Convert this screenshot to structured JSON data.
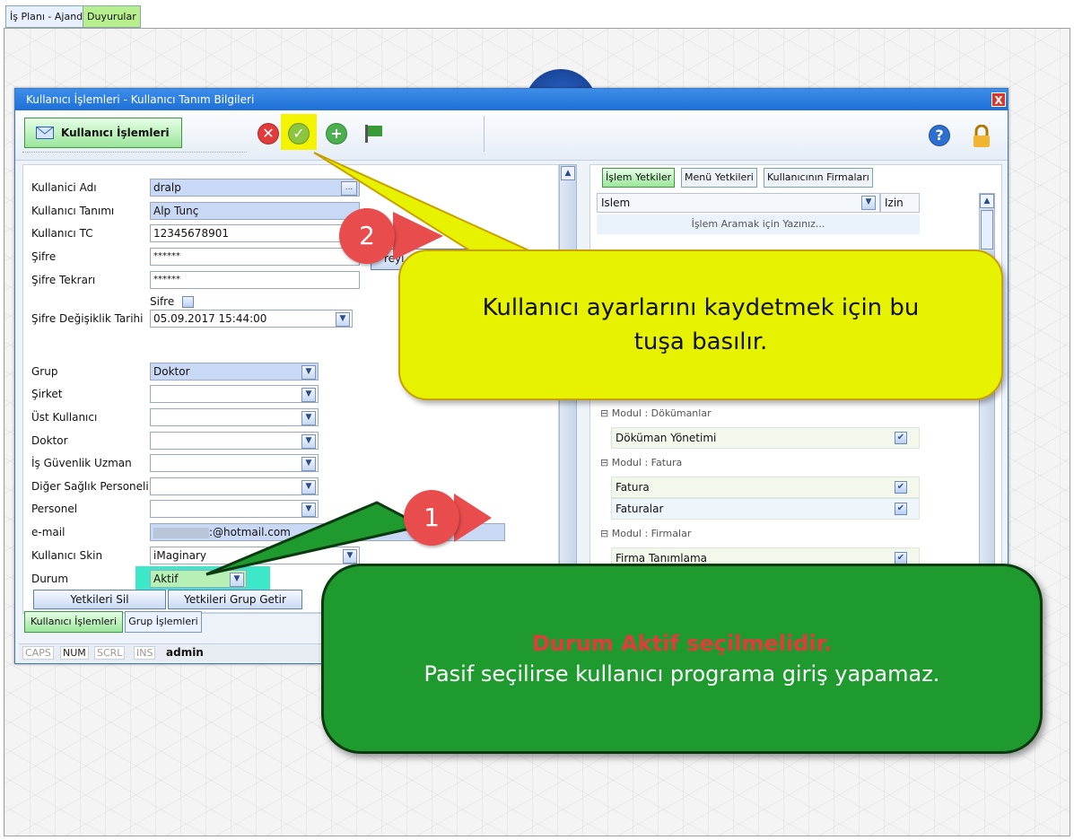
{
  "top_tabs": [
    "İş Planı - Ajanda",
    "Duyurular"
  ],
  "window": {
    "title": "Kullanıcı İşlemleri - Kullanıcı Tanım Bilgileri",
    "close": "X",
    "main_button": "Kullanıcı İşlemleri"
  },
  "toolbar": {
    "icons": [
      "cancel-icon",
      "save-check-icon",
      "add-icon",
      "exit-flag-icon",
      "help-icon",
      "lock-icon"
    ]
  },
  "form": {
    "labels": {
      "username": "Kullanici Adı",
      "definition": "Kullanıcı Tanımı",
      "tc": "Kullanıcı TC",
      "password": "Şifre",
      "password_repeat": "Şifre Tekrarı",
      "password_change_date": "Şifre Değişiklik Tarihi",
      "group": "Grup",
      "company": "Şirket",
      "parent_user": "Üst Kullanıcı",
      "doctor": "Doktor",
      "safety_specialist": "İş Güvenlik Uzman",
      "other_health": "Diğer Sağlık Personeli",
      "personnel": "Personel",
      "email": "e-mail",
      "skin": "Kullanıcı Skin",
      "status": "Durum"
    },
    "values": {
      "username": "dralp",
      "username_btn": "...",
      "definition": "Alp Tunç",
      "tc": "12345678901",
      "password": "******",
      "password_repeat": "******",
      "password_checkbox_label": "Sifre",
      "password_change_date": "05.09.2017 15:44:00",
      "group": "Doktor",
      "company": "",
      "parent_user": "",
      "doctor": "",
      "safety_specialist": "",
      "other_health": "",
      "personnel": "",
      "email": ":@hotmail.com",
      "skin": "iMaginary",
      "status": "Aktif",
      "email_button_partial": "reyi e-m"
    },
    "buttons": {
      "delete_perms": "Yetkileri Sil",
      "get_group_perms": "Yetkileri Grup Getir"
    }
  },
  "bottom_tabs": [
    "Kullanıcı İşlemleri",
    "Grup İşlemleri"
  ],
  "status_bar": [
    "CAPS",
    "NUM",
    "SCRL",
    "INS",
    "admin"
  ],
  "right_panel": {
    "tabs": [
      "İşlem Yetkiler",
      "Menü Yetkileri",
      "Kullanıcının Firmaları"
    ],
    "columns": [
      "Islem",
      "Izin"
    ],
    "search_hint": "İşlem Aramak için Yazınız...",
    "groups": [
      {
        "title": "Modul : Dökümanlar",
        "items": [
          "Döküman Yönetimi"
        ]
      },
      {
        "title": "Modul : Fatura",
        "items": [
          "Fatura",
          "Faturalar"
        ]
      },
      {
        "title": "Modul : Firmalar",
        "items": [
          "Firma Tanımlama"
        ]
      }
    ],
    "check_mark": "✔"
  },
  "callouts": {
    "badge1": "1",
    "badge2": "2",
    "callout_save": "Kullanıcı ayarlarını kaydetmek için bu tuşa basılır.",
    "callout_status_title": "Durum Aktif seçilmelidir.",
    "callout_status_body": "Pasif seçilirse kullanıcı programa giriş yapamaz."
  },
  "colors": {
    "callout_yellow": "#e6f200",
    "callout_green": "#1f9a2f",
    "highlight_red": "#e23b3b",
    "title_blue": "#2a7ee0"
  }
}
